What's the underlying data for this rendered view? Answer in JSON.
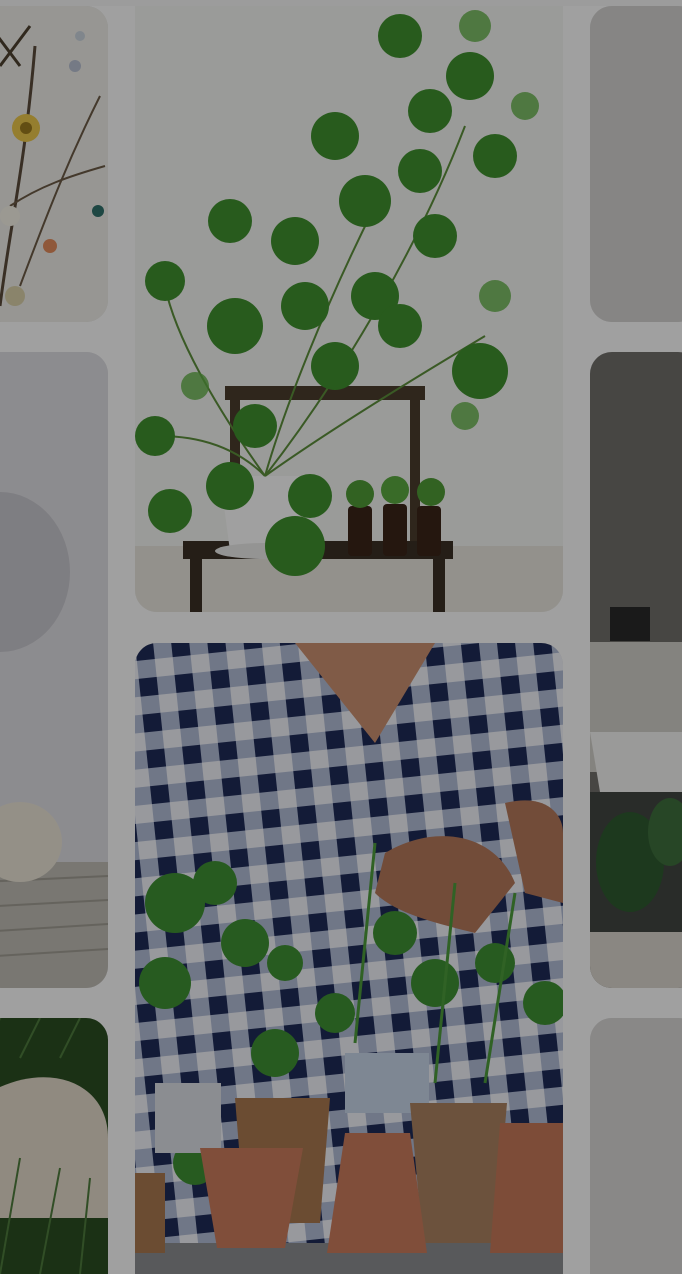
{
  "feed": {
    "pins": [
      {
        "id": "pin-1",
        "subject": "dried-flowers"
      },
      {
        "id": "pin-2",
        "subject": "pilea-plant-stool"
      },
      {
        "id": "pin-3",
        "subject": "grey-wall"
      },
      {
        "id": "pin-4",
        "subject": "interior-wall-floor"
      },
      {
        "id": "pin-5",
        "subject": "herb-pots-gingham"
      },
      {
        "id": "pin-6",
        "subject": "bathroom-tub-plant"
      },
      {
        "id": "pin-7",
        "subject": "garden-stone"
      },
      {
        "id": "pin-8",
        "subject": "blank"
      }
    ]
  },
  "colors": {
    "overlay": "rgba(0,0,0,0.36)",
    "page_bg": "#fafafa",
    "leaf": "#3f8f2e",
    "terracotta": "#c97b5c"
  }
}
